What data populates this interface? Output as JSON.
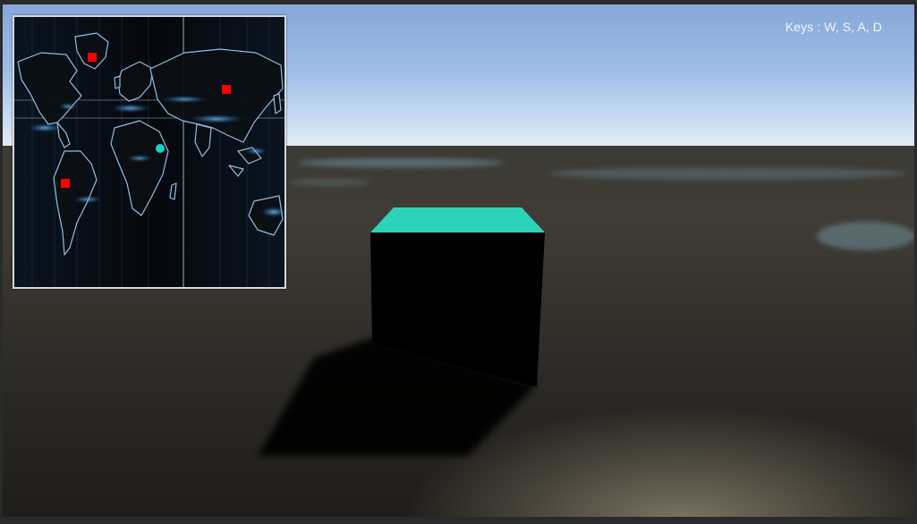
{
  "hud": {
    "keys_hint": "Keys : W, S, A, D"
  },
  "minimap": {
    "background": "world-map",
    "player_color": "#19d3c5",
    "target_color": "#ff0000",
    "target_count": 3
  },
  "scene": {
    "cube_top_color": "#2dd3b8",
    "cube_side_color": "#000000",
    "sky_color": "#9dbce6",
    "ground_color": "#3c3a35"
  }
}
